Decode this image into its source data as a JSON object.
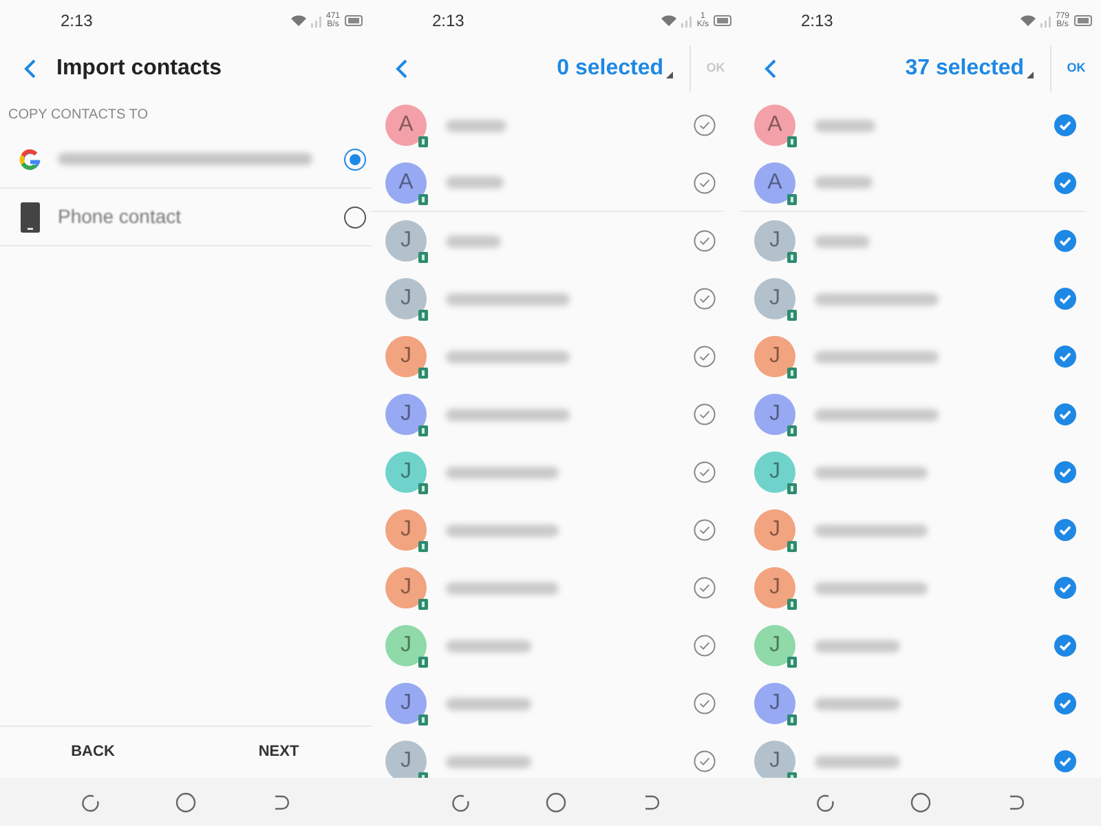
{
  "screens": [
    {
      "kind": "import",
      "status_bar": {
        "time": "2:13",
        "speed": "471",
        "speed_unit": "B/s"
      },
      "header": {
        "title": "Import contacts"
      },
      "section_label": "COPY CONTACTS TO",
      "options": [
        {
          "kind": "google",
          "selected": true
        },
        {
          "kind": "phone",
          "label": "Phone contact",
          "selected": false
        }
      ],
      "buttons": [
        "BACK",
        "NEXT"
      ]
    },
    {
      "kind": "select",
      "status_bar": {
        "time": "2:13",
        "speed": "1",
        "speed_unit": "K/s"
      },
      "header": {
        "title": "0 selected",
        "ok": "OK",
        "ok_enabled": false
      },
      "contacts": [
        {
          "letter": "A",
          "color": "#f4a0a8",
          "selected": false
        },
        {
          "letter": "A",
          "color": "#97a9f2",
          "selected": false
        },
        {
          "letter": "J",
          "color": "#b3c1cc",
          "selected": false
        },
        {
          "letter": "J",
          "color": "#b3c1cc",
          "selected": false
        },
        {
          "letter": "J",
          "color": "#f2a37f",
          "selected": false
        },
        {
          "letter": "J",
          "color": "#97a9f2",
          "selected": false
        },
        {
          "letter": "J",
          "color": "#6fd3cc",
          "selected": false
        },
        {
          "letter": "J",
          "color": "#f2a37f",
          "selected": false
        },
        {
          "letter": "J",
          "color": "#f2a37f",
          "selected": false
        },
        {
          "letter": "J",
          "color": "#8fdaa8",
          "selected": false
        },
        {
          "letter": "J",
          "color": "#97a9f2",
          "selected": false
        },
        {
          "letter": "J",
          "color": "#b3c1cc",
          "selected": false
        }
      ]
    },
    {
      "kind": "select",
      "status_bar": {
        "time": "2:13",
        "speed": "779",
        "speed_unit": "B/s"
      },
      "header": {
        "title": "37 selected",
        "ok": "OK",
        "ok_enabled": true
      },
      "contacts": [
        {
          "letter": "A",
          "color": "#f4a0a8",
          "selected": true
        },
        {
          "letter": "A",
          "color": "#97a9f2",
          "selected": true
        },
        {
          "letter": "J",
          "color": "#b3c1cc",
          "selected": true
        },
        {
          "letter": "J",
          "color": "#b3c1cc",
          "selected": true
        },
        {
          "letter": "J",
          "color": "#f2a37f",
          "selected": true
        },
        {
          "letter": "J",
          "color": "#97a9f2",
          "selected": true
        },
        {
          "letter": "J",
          "color": "#6fd3cc",
          "selected": true
        },
        {
          "letter": "J",
          "color": "#f2a37f",
          "selected": true
        },
        {
          "letter": "J",
          "color": "#f2a37f",
          "selected": true
        },
        {
          "letter": "J",
          "color": "#8fdaa8",
          "selected": true
        },
        {
          "letter": "J",
          "color": "#97a9f2",
          "selected": true
        },
        {
          "letter": "J",
          "color": "#b3c1cc",
          "selected": true
        }
      ]
    }
  ]
}
